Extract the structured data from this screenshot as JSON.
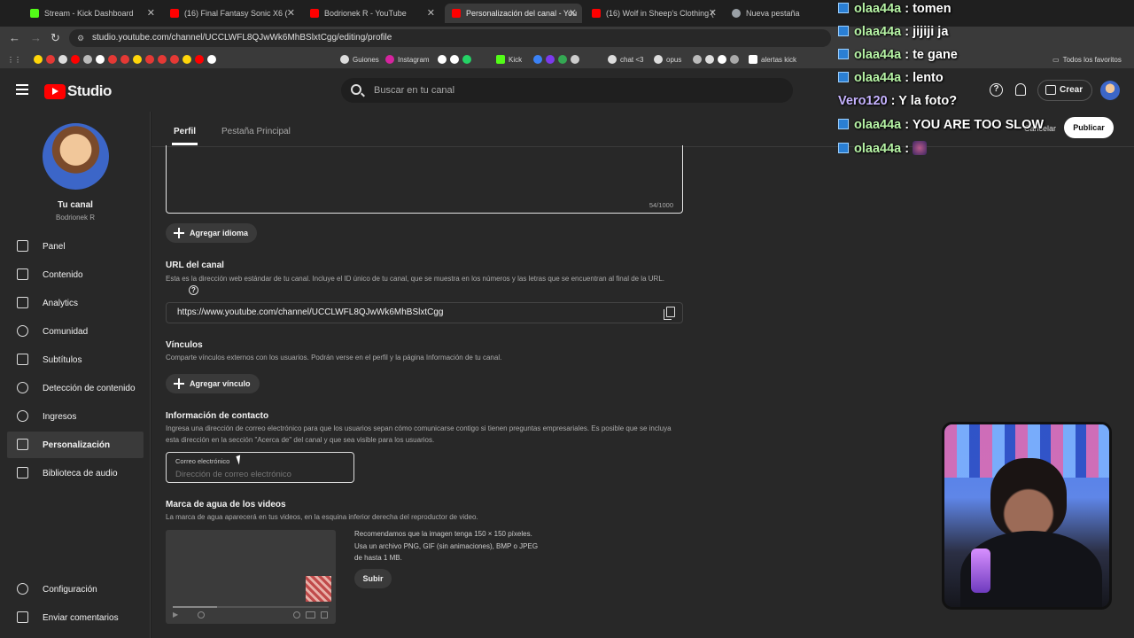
{
  "browser": {
    "tabs": [
      {
        "title": "Stream - Kick Dashboard",
        "color": "#53fc18"
      },
      {
        "title": "(16) Final Fantasy Sonic X6 (",
        "color": "#ff0000"
      },
      {
        "title": "Bodrionek R - YouTube",
        "color": "#ff0000"
      },
      {
        "title": "Personalización del canal - You",
        "color": "#ff0000"
      },
      {
        "title": "(16) Wolf in Sheep's Clothing (",
        "color": "#ff0000"
      },
      {
        "title": "Nueva pestaña",
        "color": "#9aa0a6"
      }
    ],
    "url": "studio.youtube.com/channel/UCCLWFL8QJwWk6MhBSlxtCgg/editing/profile",
    "bookmarks": [
      "Guiones",
      "Instagram",
      "Kick",
      "chat <3",
      "opus",
      "alertas kick"
    ],
    "all_bookmarks": "Todos los favoritos"
  },
  "studio": {
    "logo_text": "Studio",
    "search_placeholder": "Buscar en tu canal",
    "create_label": "Crear"
  },
  "sidebar": {
    "channel_title": "Tu canal",
    "channel_handle": "Bodrionek R",
    "items": [
      {
        "label": "Panel"
      },
      {
        "label": "Contenido"
      },
      {
        "label": "Analytics"
      },
      {
        "label": "Comunidad"
      },
      {
        "label": "Subtítulos"
      },
      {
        "label": "Detección de contenido"
      },
      {
        "label": "Ingresos"
      },
      {
        "label": "Personalización",
        "active": true
      },
      {
        "label": "Biblioteca de audio"
      }
    ],
    "bottom_items": [
      {
        "label": "Configuración"
      },
      {
        "label": "Enviar comentarios"
      }
    ]
  },
  "main": {
    "tabs": [
      {
        "label": "Perfil"
      },
      {
        "label": "Pestaña Principal"
      }
    ],
    "cancel_label": "Cancelar",
    "publish_label": "Publicar",
    "description_counter": "54/1000",
    "add_language_label": "Agregar idioma",
    "url_section": {
      "title": "URL del canal",
      "desc": "Esta es la dirección web estándar de tu canal. Incluye el ID único de tu canal, que se muestra en los números y las letras que se encuentran al final de la URL.",
      "value": "https://www.youtube.com/channel/UCCLWFL8QJwWk6MhBSlxtCgg"
    },
    "links_section": {
      "title": "Vínculos",
      "desc": "Comparte vínculos externos con los usuarios. Podrán verse en el perfil y la página Información de tu canal.",
      "add_label": "Agregar vínculo"
    },
    "contact_section": {
      "title": "Información de contacto",
      "desc": "Ingresa una dirección de correo electrónico para que los usuarios sepan cómo comunicarse contigo si tienen preguntas empresariales. Es posible que se incluya esta dirección en la sección \"Acerca de\" del canal y que sea visible para los usuarios.",
      "email_label": "Correo electrónico",
      "email_placeholder": "Dirección de correo electrónico"
    },
    "watermark_section": {
      "title": "Marca de agua de los videos",
      "desc": "La marca de agua aparecerá en tus videos, en la esquina inferior derecha del reproductor de video.",
      "rec_line1": "Recomendamos que la imagen tenga 150 × 150 píxeles.",
      "rec_line2": "Usa un archivo PNG, GIF (sin animaciones), BMP o JPEG",
      "rec_line3": "de hasta 1 MB.",
      "upload_label": "Subir"
    }
  },
  "chat": [
    {
      "user": "olaa44a",
      "msg": ": tomen"
    },
    {
      "user": "olaa44a",
      "msg": ": jijiji ja"
    },
    {
      "user": "olaa44a",
      "msg": ": te gane"
    },
    {
      "user": "olaa44a",
      "msg": ": lento"
    },
    {
      "user": "Vero120",
      "msg": ": Y la foto?"
    },
    {
      "user": "olaa44a",
      "msg": ": YOU ARE TOO SLOW"
    },
    {
      "user": "olaa44a",
      "msg": ":"
    }
  ]
}
